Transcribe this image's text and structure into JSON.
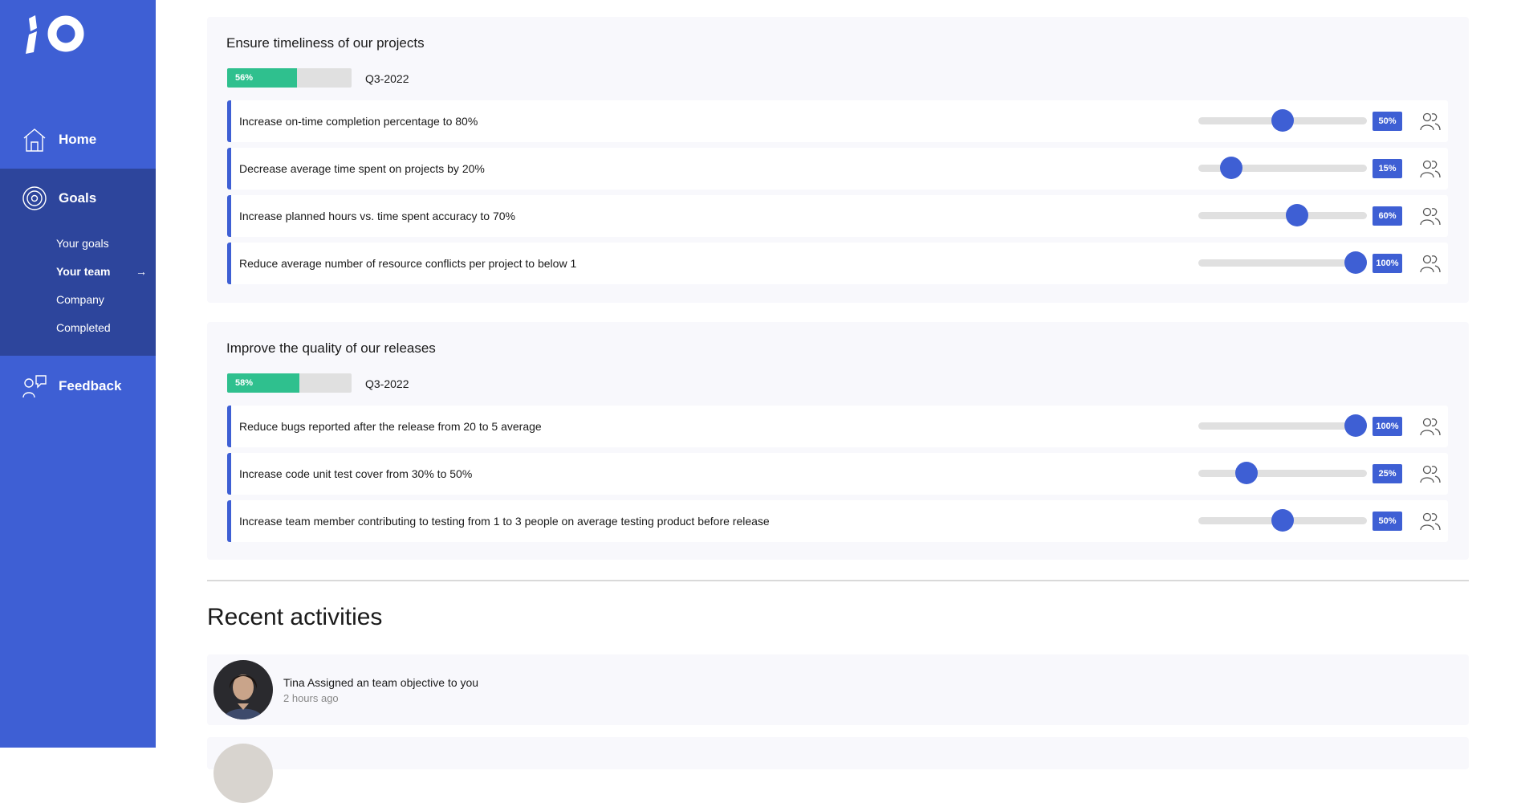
{
  "sidebar": {
    "home": "Home",
    "goals": "Goals",
    "goals_sub": [
      {
        "label": "Your goals",
        "active": false
      },
      {
        "label": "Your team",
        "active": true
      },
      {
        "label": "Company",
        "active": false
      },
      {
        "label": "Completed",
        "active": false
      }
    ],
    "active_arrow": "→",
    "feedback": "Feedback"
  },
  "goals": [
    {
      "title": "Ensure timeliness of our projects",
      "progress": 56,
      "progress_label": "56%",
      "quarter": "Q3-2022",
      "key_results": [
        {
          "label": "Increase on-time completion percentage to 80%",
          "value": 50,
          "value_label": "50%"
        },
        {
          "label": "Decrease average time spent on projects by 20%",
          "value": 15,
          "value_label": "15%"
        },
        {
          "label": "Increase planned hours vs. time spent accuracy to 70%",
          "value": 60,
          "value_label": "60%"
        },
        {
          "label": "Reduce average number of resource conflicts per project to below 1",
          "value": 100,
          "value_label": "100%"
        }
      ]
    },
    {
      "title": "Improve the quality of our releases",
      "progress": 58,
      "progress_label": "58%",
      "quarter": "Q3-2022",
      "key_results": [
        {
          "label": "Reduce bugs reported after the release from 20 to 5 average",
          "value": 100,
          "value_label": "100%"
        },
        {
          "label": "Increase code unit test cover from 30% to 50%",
          "value": 25,
          "value_label": "25%"
        },
        {
          "label": "Increase team member contributing to testing from 1 to 3 people on average testing product before release",
          "value": 50,
          "value_label": "50%"
        }
      ]
    }
  ],
  "recent": {
    "title": "Recent activities",
    "items": [
      {
        "text": "Tina Assigned an team objective to you",
        "time": "2 hours ago"
      }
    ]
  },
  "colors": {
    "brand": "#3e5fd4",
    "brand_dark": "#2d459c",
    "progress_green": "#2fc08e",
    "track_gray": "#e0e0e0",
    "card_bg": "#f8f8fc"
  },
  "icons": {
    "logo": "io-logo",
    "home": "home-icon",
    "goals": "target-icon",
    "feedback": "feedback-icon",
    "team": "people-icon",
    "arrow": "arrow-right-icon"
  }
}
